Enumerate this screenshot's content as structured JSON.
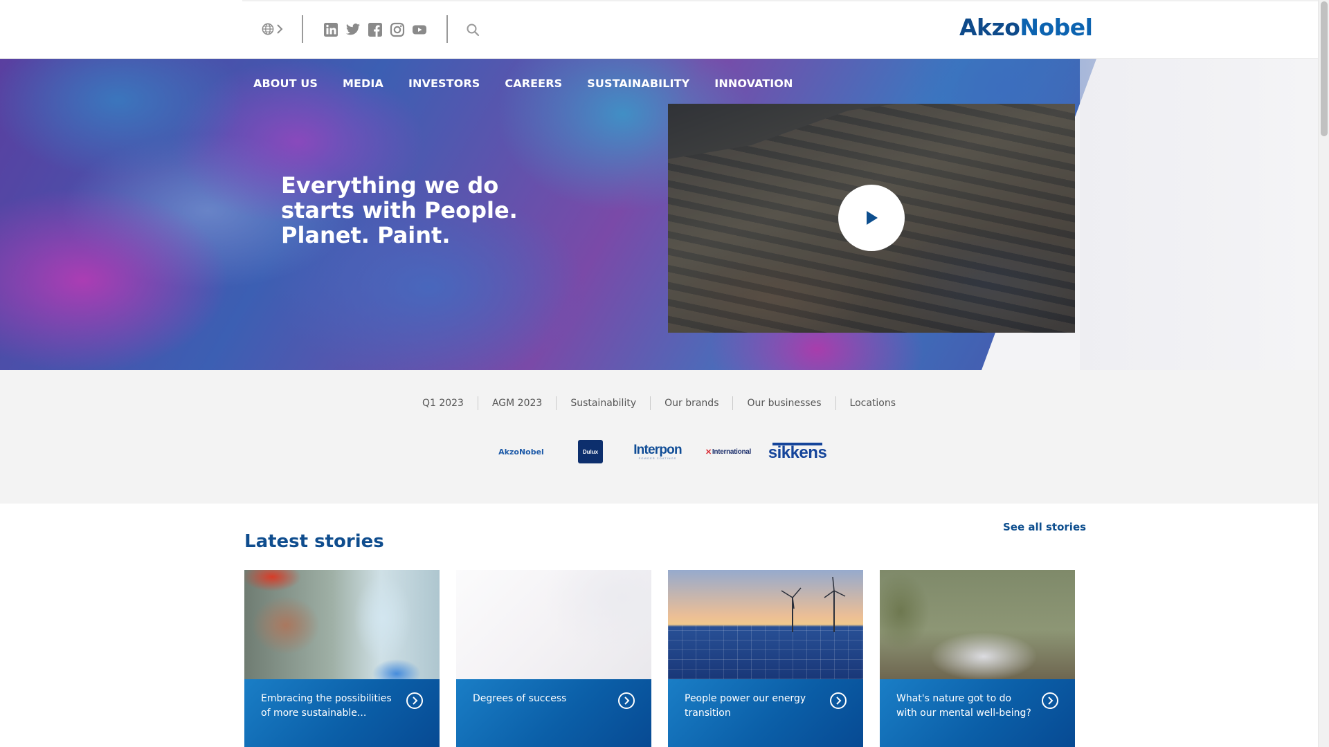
{
  "header": {
    "logo_left": "Akzo",
    "logo_right": "Nobel",
    "social_icons": [
      "linkedin-icon",
      "twitter-icon",
      "facebook-icon",
      "instagram-icon",
      "youtube-icon"
    ]
  },
  "nav": {
    "items": [
      {
        "label": "ABOUT US"
      },
      {
        "label": "MEDIA"
      },
      {
        "label": "INVESTORS"
      },
      {
        "label": "CAREERS"
      },
      {
        "label": "SUSTAINABILITY"
      },
      {
        "label": "INNOVATION"
      }
    ]
  },
  "hero": {
    "title": "Everything we do starts with People. Planet. Paint."
  },
  "quicklinks": [
    {
      "label": "Q1 2023"
    },
    {
      "label": "AGM 2023"
    },
    {
      "label": "Sustainability"
    },
    {
      "label": "Our brands"
    },
    {
      "label": "Our businesses"
    },
    {
      "label": "Locations"
    }
  ],
  "brands": {
    "akzonobel": "AkzoNobel",
    "dulux": "Dulux",
    "interpon": "Interpon",
    "interpon_sub": "POWDER COATINGS",
    "international": "International",
    "sikkens": "sikkens"
  },
  "stories": {
    "title": "Latest stories",
    "see_all": "See all stories",
    "cards": [
      {
        "caption": "Embracing the possibilities of more sustainable..."
      },
      {
        "caption": "Degrees of success"
      },
      {
        "caption": "People power our energy transition"
      },
      {
        "caption": "What's nature got to do with our mental well-being?"
      }
    ]
  },
  "colors": {
    "brand_blue": "#0d4e8e",
    "card_blue": "#0b5fa8",
    "quick_bg": "#f3f3f3"
  }
}
